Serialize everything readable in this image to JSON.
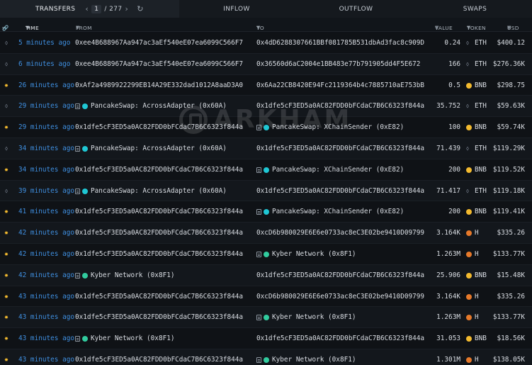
{
  "colors": {
    "eth": "#8891a0",
    "bnb": "#f3ba2f",
    "h": "#e6792a",
    "pancake": "#1fc7d4",
    "kyber": "#31cb9e"
  },
  "tabs": {
    "transfers": "TRANSFERS",
    "page": "1",
    "total": "/ 277",
    "inflow": "INFLOW",
    "outflow": "OUTFLOW",
    "swaps": "SWAPS"
  },
  "icons": {
    "prev": "chevron-left-icon",
    "next": "chevron-right-icon",
    "refresh": "refresh-icon",
    "direction": "direction-icon",
    "link": "link-icon",
    "document": "document-icon"
  },
  "header": {
    "time": "TIME",
    "from": "FROM",
    "to": "TO",
    "value": "VALUE",
    "token": "TOKEN",
    "usd": "USD"
  },
  "watermark": "ARKHAM",
  "rows": [
    {
      "dir": "eth",
      "time": "5 minutes ago",
      "from": "0xee4B688967Aa947ac3aEf540eE07ea6099C566F7",
      "to": "0x4dD6288307661BBf081785B531dbAd3fac8c909D",
      "value": "0.24",
      "token": "ETH",
      "usd": "$400.12"
    },
    {
      "dir": "eth",
      "time": "6 minutes ago",
      "from": "0xee4B688967Aa947ac3aEf540eE07ea6099C566F7",
      "to": "0x36560d6aC2004e1BB483e77b791905dd4F5E672",
      "value": "166",
      "token": "ETH",
      "usd": "$276.36K"
    },
    {
      "dir": "bnb",
      "time": "26 minutes ago",
      "from": "0xAf2a4989922299EB14A29E332dad1012A8aaD3A0",
      "to": "0x6Aa22CB8420E94Fc2119364b4c7885710aE753bB",
      "value": "0.5",
      "token": "BNB",
      "usd": "$298.75"
    },
    {
      "dir": "eth",
      "time": "29 minutes ago",
      "from": "PancakeSwap: AcrossAdapter (0x60A)",
      "fromEntity": "pancake",
      "to": "0x1dfe5cF3ED5a0AC82FDD0bFCdaC7B6C6323f844a",
      "value": "35.752",
      "token": "ETH",
      "usd": "$59.63K"
    },
    {
      "dir": "bnb",
      "time": "29 minutes ago",
      "from": "0x1dfe5cF3ED5a0AC82FDD0bFCdaC7B6C6323f844a",
      "to": "PancakeSwap: XChainSender (0xE82)",
      "toEntity": "pancake",
      "value": "100",
      "token": "BNB",
      "usd": "$59.74K"
    },
    {
      "dir": "eth",
      "time": "34 minutes ago",
      "from": "PancakeSwap: AcrossAdapter (0x60A)",
      "fromEntity": "pancake",
      "to": "0x1dfe5cF3ED5a0AC82FDD0bFCdaC7B6C6323f844a",
      "value": "71.439",
      "token": "ETH",
      "usd": "$119.29K"
    },
    {
      "dir": "bnb",
      "time": "34 minutes ago",
      "from": "0x1dfe5cF3ED5a0AC82FDD0bFCdaC7B6C6323f844a",
      "to": "PancakeSwap: XChainSender (0xE82)",
      "toEntity": "pancake",
      "value": "200",
      "token": "BNB",
      "usd": "$119.52K"
    },
    {
      "dir": "eth",
      "time": "39 minutes ago",
      "from": "PancakeSwap: AcrossAdapter (0x60A)",
      "fromEntity": "pancake",
      "to": "0x1dfe5cF3ED5a0AC82FDD0bFCdaC7B6C6323f844a",
      "value": "71.417",
      "token": "ETH",
      "usd": "$119.18K"
    },
    {
      "dir": "bnb",
      "time": "41 minutes ago",
      "from": "0x1dfe5cF3ED5a0AC82FDD0bFCdaC7B6C6323f844a",
      "to": "PancakeSwap: XChainSender (0xE82)",
      "toEntity": "pancake",
      "value": "200",
      "token": "BNB",
      "usd": "$119.41K"
    },
    {
      "dir": "bnb",
      "time": "42 minutes ago",
      "from": "0x1dfe5cF3ED5a0AC82FDD0bFCdaC7B6C6323f844a",
      "to": "0xcD6b980029E6E6e0733ac8eC3E02be9410D09799",
      "value": "3.164K",
      "token": "H",
      "usd": "$335.26"
    },
    {
      "dir": "bnb",
      "time": "42 minutes ago",
      "from": "0x1dfe5cF3ED5a0AC82FDD0bFCdaC7B6C6323f844a",
      "to": "Kyber Network (0x8F1)",
      "toEntity": "kyber",
      "value": "1.263M",
      "token": "H",
      "usd": "$133.77K"
    },
    {
      "dir": "bnb",
      "time": "42 minutes ago",
      "from": "Kyber Network (0x8F1)",
      "fromEntity": "kyber",
      "to": "0x1dfe5cF3ED5a0AC82FDD0bFCdaC7B6C6323f844a",
      "value": "25.906",
      "token": "BNB",
      "usd": "$15.48K"
    },
    {
      "dir": "bnb",
      "time": "43 minutes ago",
      "from": "0x1dfe5cF3ED5a0AC82FDD0bFCdaC7B6C6323f844a",
      "to": "0xcD6b980029E6E6e0733ac8eC3E02be9410D09799",
      "value": "3.164K",
      "token": "H",
      "usd": "$335.26"
    },
    {
      "dir": "bnb",
      "time": "43 minutes ago",
      "from": "0x1dfe5cF3ED5a0AC82FDD0bFCdaC7B6C6323f844a",
      "to": "Kyber Network (0x8F1)",
      "toEntity": "kyber",
      "value": "1.263M",
      "token": "H",
      "usd": "$133.77K"
    },
    {
      "dir": "bnb",
      "time": "43 minutes ago",
      "from": "Kyber Network (0x8F1)",
      "fromEntity": "kyber",
      "to": "0x1dfe5cF3ED5a0AC82FDD0bFCdaC7B6C6323f844a",
      "value": "31.053",
      "token": "BNB",
      "usd": "$18.56K"
    },
    {
      "dir": "bnb",
      "time": "43 minutes ago",
      "from": "0x1dfe5cF3ED5a0AC82FDD0bFCdaC7B6C6323f844a",
      "to": "Kyber Network (0x8F1)",
      "toEntity": "kyber",
      "value": "1.301M",
      "token": "H",
      "usd": "$138.05K"
    }
  ]
}
